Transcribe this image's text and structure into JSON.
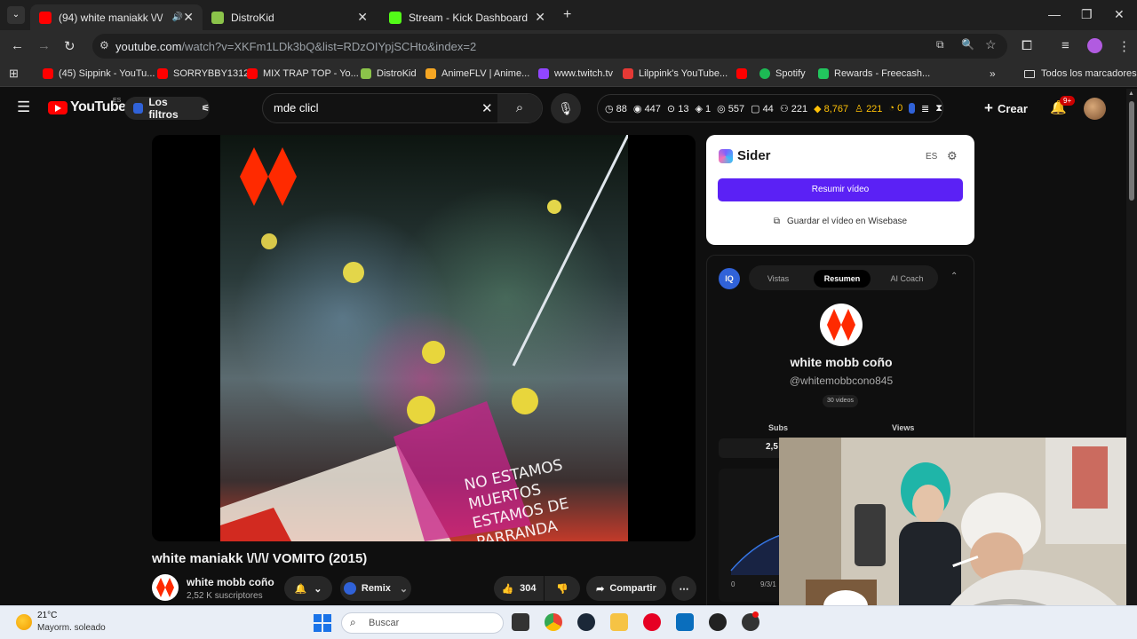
{
  "browser": {
    "tabs": [
      {
        "title": "(94) white maniakk \\/\\/ VOMITO",
        "active": true,
        "favicon_color": "#ff0000"
      },
      {
        "title": "DistroKid",
        "active": false,
        "favicon_color": "#8bc34a"
      },
      {
        "title": "Stream - Kick Dashboard",
        "active": false,
        "favicon_color": "#53fc18"
      }
    ],
    "url_host": "youtube.com",
    "url_path": "/watch?v=XKFm1LDk3bQ&list=RDzOIYpjSCHto&index=2",
    "bookmarks": [
      {
        "label": "(45) Sippink - YouTu...",
        "color": "#ff0000"
      },
      {
        "label": "SORRYBBY1312",
        "color": "#ff0000"
      },
      {
        "label": "MIX TRAP TOP - Yo...",
        "color": "#ff0000"
      },
      {
        "label": "DistroKid",
        "color": "#8bc34a"
      },
      {
        "label": "AnimeFLV | Anime...",
        "color": "#f5a623"
      },
      {
        "label": "www.twitch.tv",
        "color": "#9146ff"
      },
      {
        "label": "Lilppink's YouTube...",
        "color": "#e53935"
      },
      {
        "label": "",
        "color": "#ff0000"
      },
      {
        "label": "Spotify",
        "color": "#1db954"
      },
      {
        "label": "Rewards - Freecash...",
        "color": "#22c55e"
      }
    ],
    "all_bookmarks": "Todos los marcadores"
  },
  "youtube": {
    "logo_text": "YouTube",
    "logo_region": "ES",
    "filters_label": "Los filtros",
    "search_value": "mde clicl",
    "stats": [
      "88",
      "447",
      "13",
      "1",
      "557",
      "44",
      "221",
      "8,767",
      "221",
      "0"
    ],
    "create_label": "Crear",
    "notifications_badge": "9+"
  },
  "video": {
    "title": "white maniakk \\/\\/\\/ VOMITO (2015)",
    "art_text_line1": "NO ESTAMOS MUERTOS",
    "art_text_line2": "ESTAMOS DE PARRANDA",
    "channel_name": "white mobb coño",
    "subscribers": "2,52 K suscriptores",
    "remix_label": "Remix",
    "likes": "304",
    "share_label": "Compartir"
  },
  "sider": {
    "title": "Sider",
    "lang": "ES",
    "summarize_label": "Resumir vídeo",
    "save_label": "Guardar el vídeo en Wisebase"
  },
  "iq_panel": {
    "badge": "IQ",
    "tabs": [
      "Vistas",
      "Resumen",
      "AI Coach"
    ],
    "selected_tab": "Resumen",
    "channel_name": "white mobb coño",
    "handle": "@whitemobbcono845",
    "videos": "30 videos",
    "subs_label": "Subs",
    "views_label": "Views",
    "subs_value": "2,5",
    "chart_x0": "0",
    "chart_x1": "9/3/1"
  },
  "taskbar": {
    "temperature": "21°C",
    "weather": "Mayorm. soleado",
    "search_placeholder": "Buscar"
  },
  "colors": {
    "yt_red": "#ff0000",
    "sider_purple": "#5b21f5",
    "iq_blue": "#3062d8",
    "gold": "#ffc107"
  }
}
